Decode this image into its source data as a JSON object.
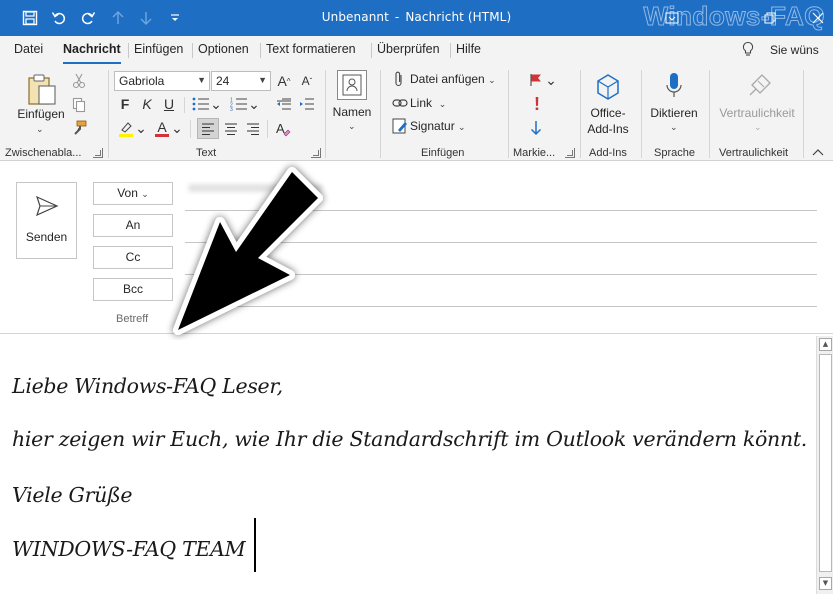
{
  "window": {
    "title_doc": "Unbenannt",
    "title_sep": "-",
    "title_type": "Nachricht (HTML)",
    "watermark": "Windows-FAQ"
  },
  "quick_access": {
    "icons": [
      "save-icon",
      "undo-icon",
      "redo-icon",
      "up-arrow-icon",
      "down-arrow-icon",
      "customize-icon"
    ]
  },
  "tabs": [
    {
      "label": "Datei"
    },
    {
      "label": "Nachricht",
      "active": true
    },
    {
      "label": "Einfügen"
    },
    {
      "label": "Optionen"
    },
    {
      "label": "Text formatieren"
    },
    {
      "label": "Überprüfen"
    },
    {
      "label": "Hilfe"
    }
  ],
  "tell_me": "Sie wüns",
  "ribbon": {
    "clipboard": {
      "paste_label": "Einfügen",
      "group_label": "Zwischenabla..."
    },
    "text": {
      "font_name": "Gabriola",
      "font_size": "24",
      "grow_glyph": "A",
      "shrink_glyph": "A",
      "bold": "F",
      "italic": "K",
      "underline": "U",
      "font_color_glyph": "A",
      "group_label": "Text"
    },
    "names": {
      "label": "Namen"
    },
    "insert": {
      "attach": "Datei anfügen",
      "link": "Link",
      "signature": "Signatur",
      "group_label": "Einfügen"
    },
    "tags": {
      "group_label": "Markie..."
    },
    "addins": {
      "label_line1": "Office-",
      "label_line2": "Add-Ins",
      "group_label": "Add-Ins"
    },
    "voice": {
      "label": "Diktieren",
      "group_label": "Sprache"
    },
    "sensitivity": {
      "label": "Vertraulichkeit",
      "group_label": "Vertraulichkeit"
    }
  },
  "header": {
    "send_label": "Senden",
    "from_label": "Von",
    "to_label": "An",
    "cc_label": "Cc",
    "bcc_label": "Bcc",
    "subject_label": "Betreff"
  },
  "body": {
    "lines": [
      "Liebe Windows-FAQ Leser,",
      "hier zeigen wir Euch, wie Ihr die Standardschrift im Outlook verändern könnt.",
      "Viele Grüße",
      "WINDOWS-FAQ TEAM"
    ]
  },
  "colors": {
    "titlebar": "#1e6fc4",
    "accent": "#1e6fc4",
    "ribbon_bg": "#f3f3f3",
    "font_color_bar": "#d13438",
    "highlight_bar": "#fff100",
    "flag": "#d13438",
    "importance_high": "#d13438",
    "importance_low": "#1e6fc4"
  }
}
